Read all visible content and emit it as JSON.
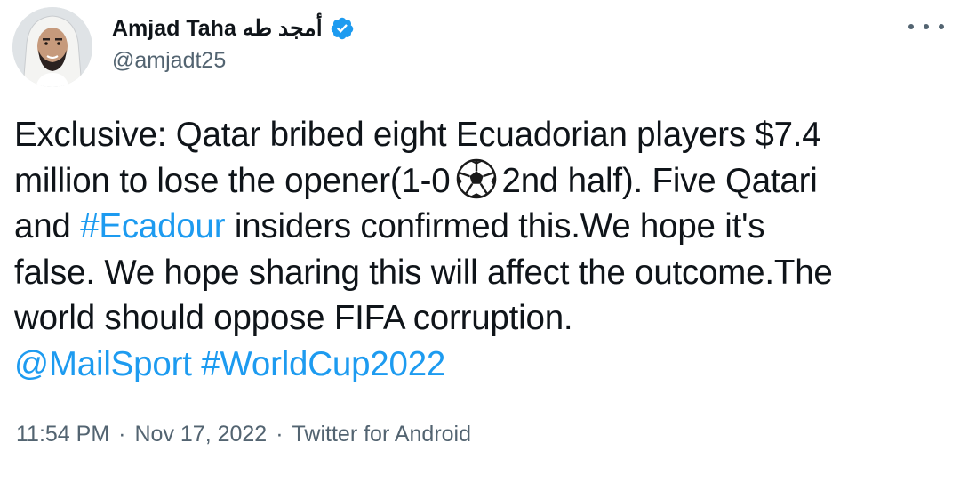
{
  "author": {
    "display_name": "Amjad Taha أمجد طه",
    "handle": "@amjadt25",
    "verified": true,
    "avatar_icon": "profile-photo"
  },
  "tweet": {
    "line1": "Exclusive: Qatar bribed eight Ecuadorian players $7.4",
    "line2_before_icon": "million to lose the opener(1-0",
    "line2_after_icon": "2nd half). Five Qatari",
    "line3_before_link": "and",
    "hashtag_ecuador": "#Ecadour",
    "line3_after_link": "insiders confirmed this.We hope it's",
    "line4": "false. We hope sharing this will affect the outcome.The",
    "line5": "world should oppose FIFA corruption.",
    "mention_mailsport": "@MailSport",
    "hashtag_worldcup": "#WorldCup2022",
    "inline_icon": "soccer-ball-emoji"
  },
  "meta": {
    "time": "11:54 PM",
    "date": "Nov 17, 2022",
    "client": "Twitter for Android",
    "separator": "·"
  },
  "colors": {
    "text": "#0f1419",
    "secondary": "#536471",
    "link": "#1d9bf0",
    "verified": "#1d9bf0"
  }
}
